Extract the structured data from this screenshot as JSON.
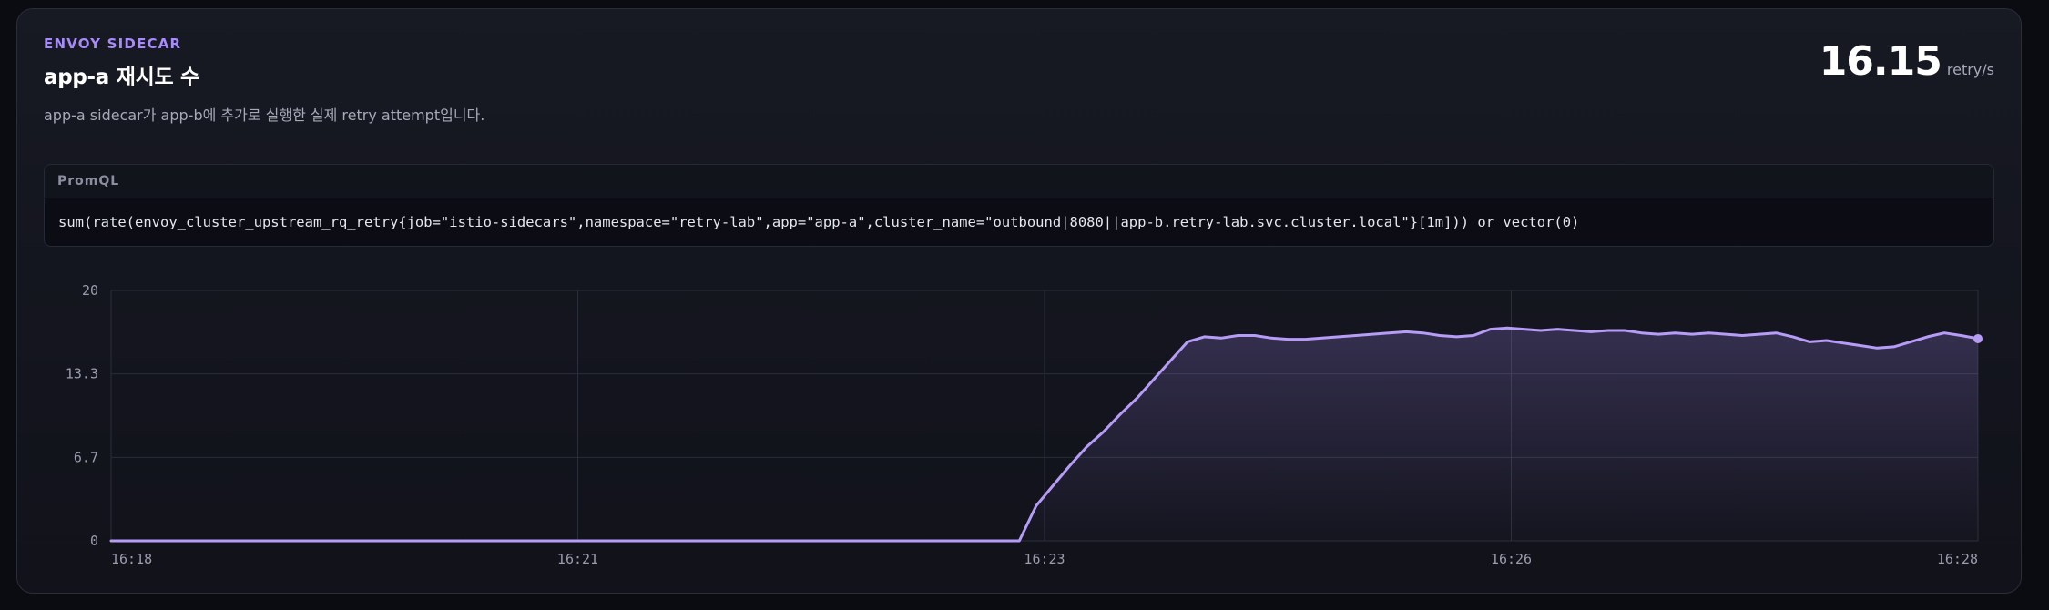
{
  "header": {
    "eyebrow": "ENVOY SIDECAR",
    "title": "app-a 재시도 수",
    "description": "app-a sidecar가 app-b에 추가로 실행한 실제 retry attempt입니다."
  },
  "metric": {
    "value": "16.15",
    "unit": "retry/s"
  },
  "query": {
    "label": "PromQL",
    "expression": "sum(rate(envoy_cluster_upstream_rq_retry{job=\"istio-sidecars\",namespace=\"retry-lab\",app=\"app-a\",cluster_name=\"outbound|8080||app-b.retry-lab.svc.cluster.local\"}[1m])) or vector(0)"
  },
  "colors": {
    "accent": "#a78bfa",
    "line": "#b79cf7"
  },
  "chart_data": {
    "type": "area",
    "title": "",
    "xlabel": "",
    "ylabel": "",
    "ylim": [
      0,
      20
    ],
    "yticks": [
      "20",
      "13.3",
      "6.7",
      "0"
    ],
    "xticks": [
      "16:18",
      "16:21",
      "16:23",
      "16:26",
      "16:28"
    ],
    "grid": true,
    "legend": "none",
    "series": [
      {
        "values": [
          0,
          0,
          0,
          0,
          0,
          0,
          0,
          0,
          0,
          0,
          0,
          0,
          0,
          0,
          0,
          0,
          0,
          0,
          0,
          0,
          0,
          0,
          0,
          0,
          0,
          0,
          0,
          0,
          0,
          0,
          0,
          0,
          0,
          0,
          0,
          0,
          0,
          0,
          0,
          0,
          0,
          0,
          0,
          0,
          0,
          0,
          0,
          0,
          0,
          0,
          0,
          0,
          0,
          0,
          0,
          2.8,
          4.4,
          6,
          7.5,
          8.7,
          10.1,
          11.4,
          12.9,
          14.4,
          15.9,
          16.3,
          16.2,
          16.4,
          16.4,
          16.2,
          16.1,
          16.1,
          16.2,
          16.3,
          16.4,
          16.5,
          16.6,
          16.7,
          16.6,
          16.4,
          16.3,
          16.4,
          16.9,
          17.0,
          16.9,
          16.8,
          16.9,
          16.8,
          16.7,
          16.8,
          16.8,
          16.6,
          16.5,
          16.6,
          16.5,
          16.6,
          16.5,
          16.4,
          16.5,
          16.6,
          16.3,
          15.9,
          16.0,
          15.8,
          15.6,
          15.4,
          15.5,
          15.9,
          16.3,
          16.6,
          16.4,
          16.15
        ]
      }
    ]
  }
}
